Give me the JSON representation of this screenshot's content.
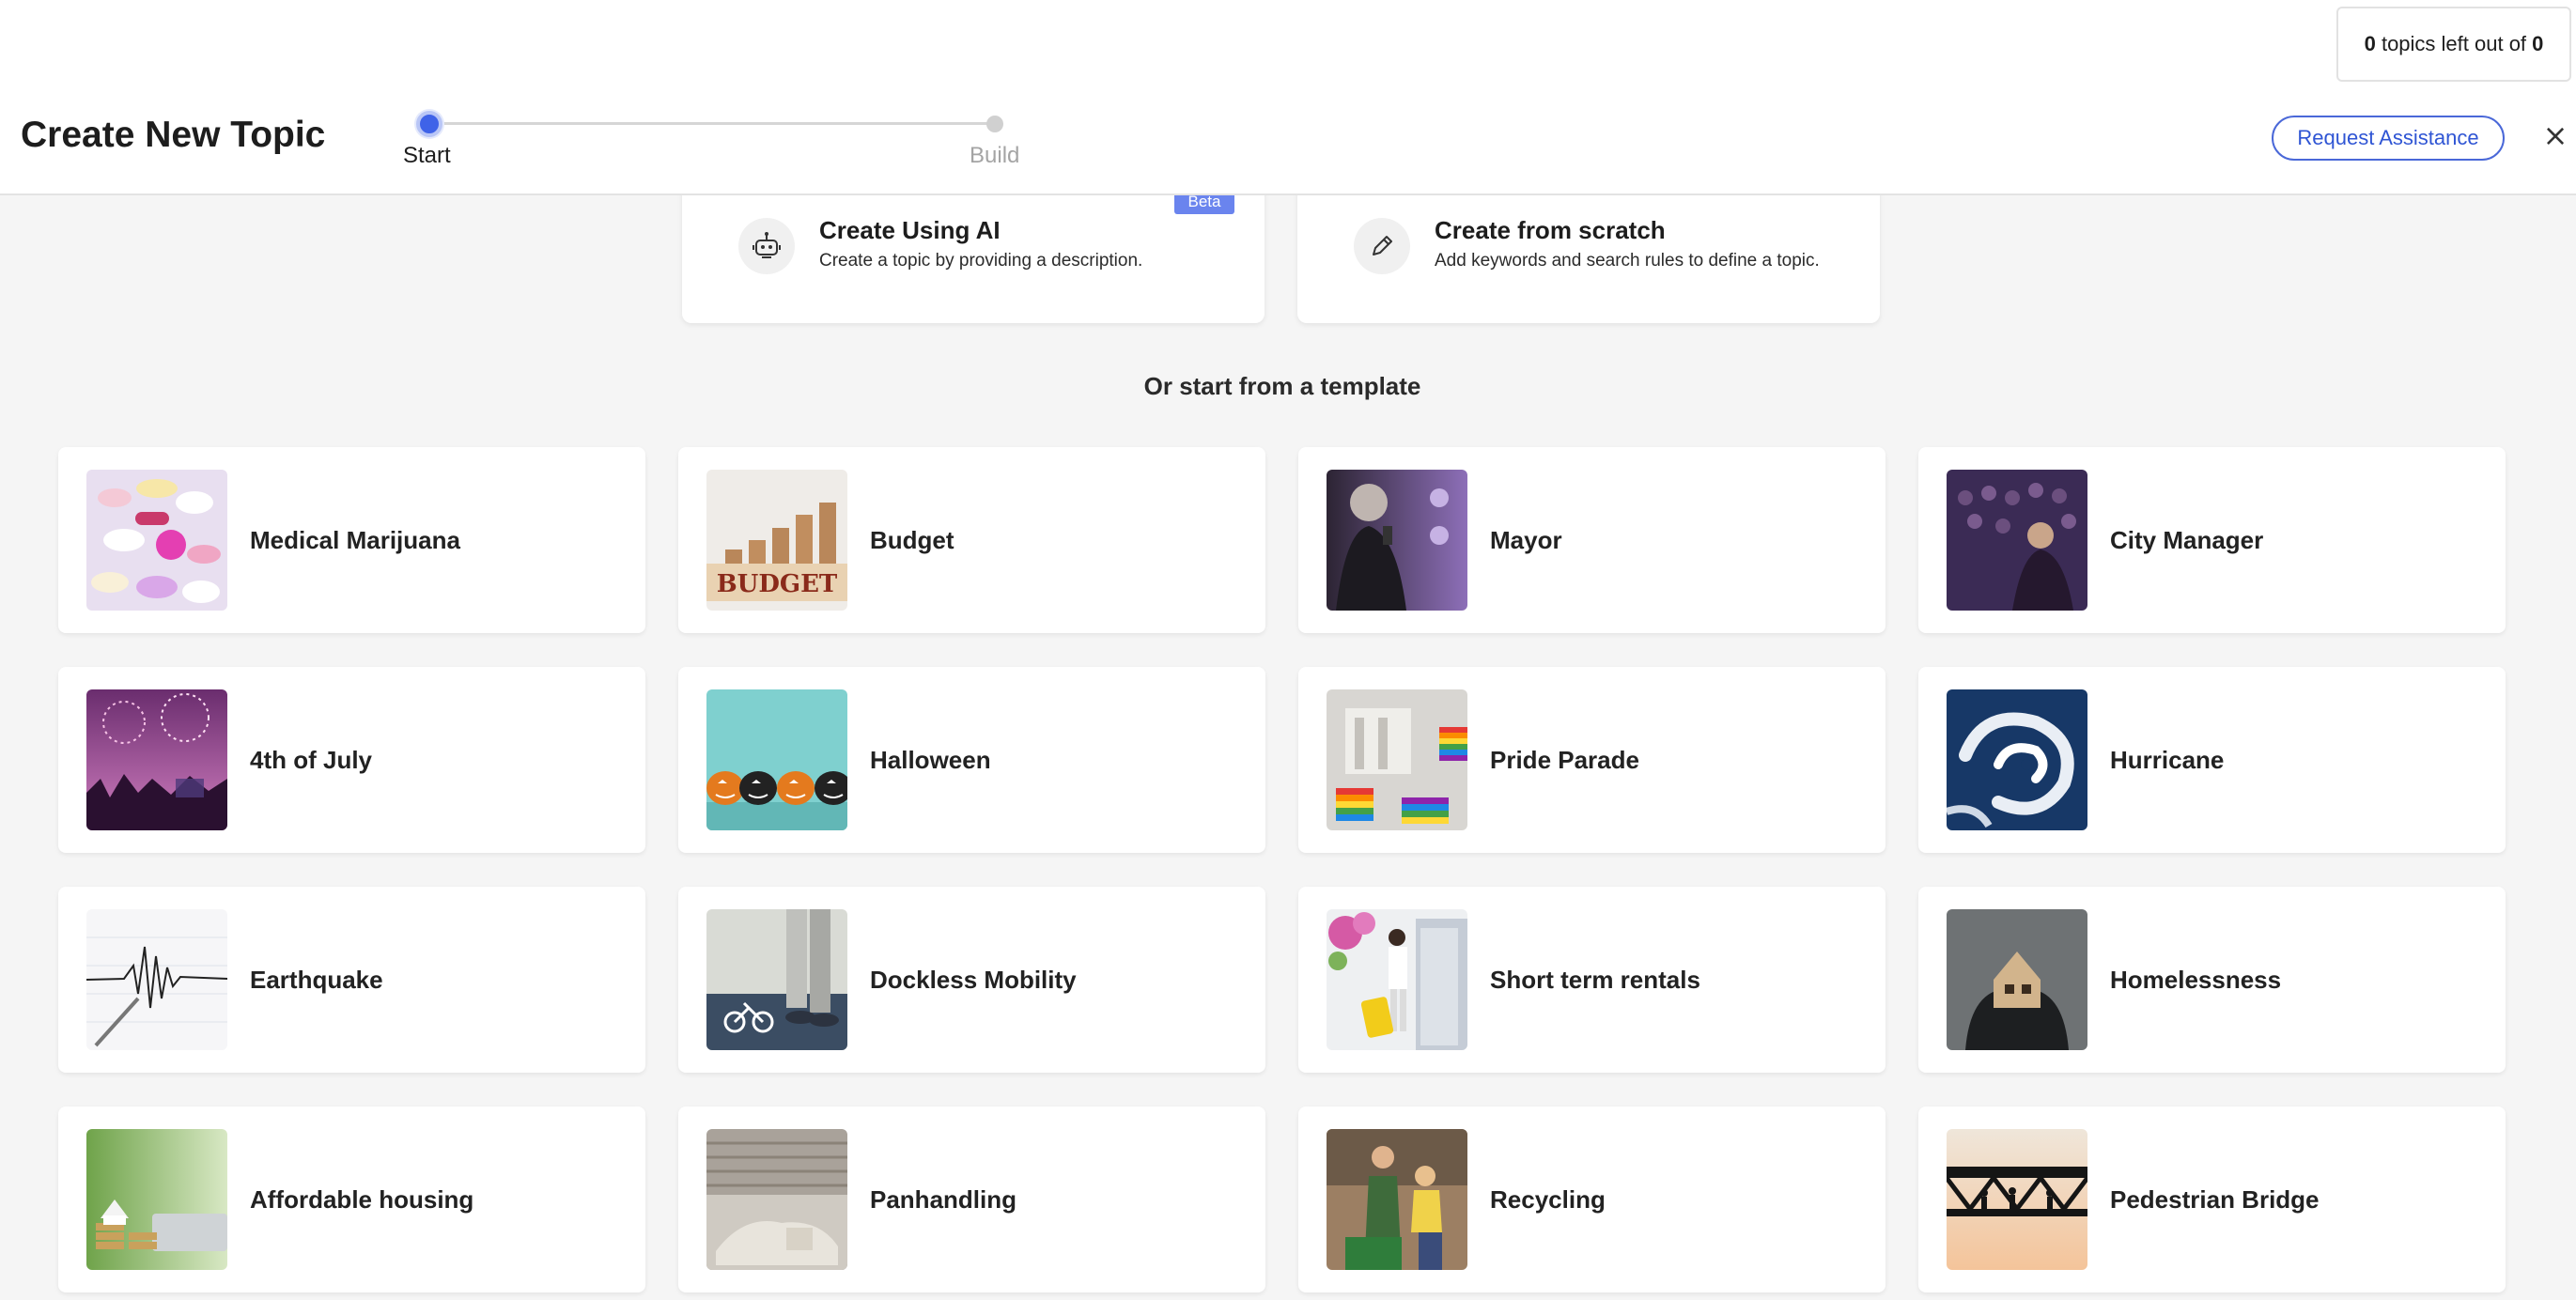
{
  "header": {
    "title": "Create New Topic",
    "steps": [
      "Start",
      "Build"
    ],
    "request_assistance": "Request Assistance",
    "close": "×"
  },
  "quota": {
    "left": "0",
    "middle": " topics left out of ",
    "total": "0"
  },
  "create_options": [
    {
      "title": "Create Using AI",
      "description": "Create a topic by providing a description.",
      "badge": "Beta",
      "icon": "robot-icon"
    },
    {
      "title": "Create from scratch",
      "description": "Add keywords and search rules to define a topic.",
      "icon": "pencil-icon"
    }
  ],
  "templates_heading": "Or start from a template",
  "templates": [
    {
      "label": "Medical Marijuana",
      "icon": "pills-image"
    },
    {
      "label": "Budget",
      "icon": "budget-coins-image",
      "image_text": "BUDGET"
    },
    {
      "label": "Mayor",
      "icon": "mayor-speaking-image"
    },
    {
      "label": "City Manager",
      "icon": "city-manager-audience-image"
    },
    {
      "label": "4th of July",
      "icon": "fireworks-image"
    },
    {
      "label": "Halloween",
      "icon": "pumpkins-image"
    },
    {
      "label": "Pride Parade",
      "icon": "pride-flags-image"
    },
    {
      "label": "Hurricane",
      "icon": "hurricane-satellite-image"
    },
    {
      "label": "Earthquake",
      "icon": "seismograph-image"
    },
    {
      "label": "Dockless Mobility",
      "icon": "bike-lane-image"
    },
    {
      "label": "Short term rentals",
      "icon": "suitcase-door-image"
    },
    {
      "label": "Homelessness",
      "icon": "house-hands-image"
    },
    {
      "label": "Affordable housing",
      "icon": "house-coins-image"
    },
    {
      "label": "Panhandling",
      "icon": "street-sleeping-image"
    },
    {
      "label": "Recycling",
      "icon": "recycling-family-image"
    },
    {
      "label": "Pedestrian Bridge",
      "icon": "bridge-silhouette-image"
    }
  ],
  "colors": {
    "accent": "#3f63e8",
    "beta_badge": "#6a84ee",
    "background": "#f5f5f5"
  }
}
